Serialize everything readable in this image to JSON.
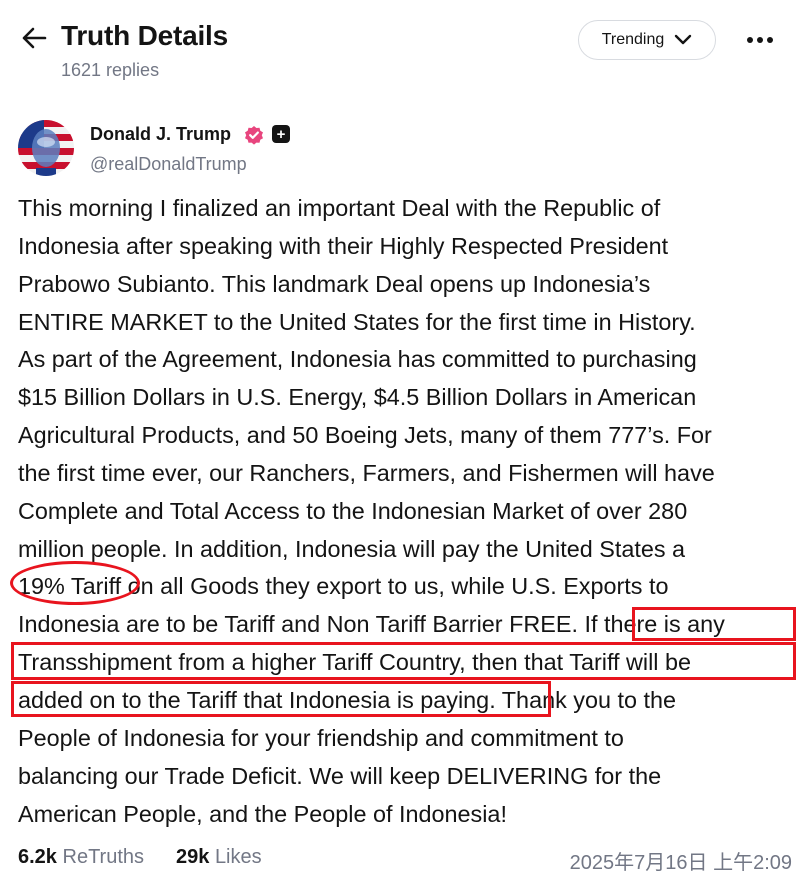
{
  "header": {
    "title": "Truth Details",
    "replies": "1621 replies",
    "trending_label": "Trending"
  },
  "author": {
    "name": "Donald J. Trump",
    "handle": "@realDonaldTrump",
    "plus_badge": "+"
  },
  "post": {
    "lines": [
      "This morning I finalized an important Deal with the Republic of",
      "Indonesia after speaking with their Highly Respected President",
      "Prabowo Subianto. This landmark Deal opens up Indonesia’s",
      "ENTIRE MARKET to the United States for the first time in History.",
      "As part of the Agreement, Indonesia has committed to purchasing",
      "$15 Billion Dollars in U.S. Energy, $4.5 Billion Dollars in American",
      "Agricultural Products, and 50 Boeing Jets, many of them 777’s. For",
      "the first time ever, our Ranchers, Farmers, and Fishermen will have",
      "Complete and Total Access to the Indonesian Market of over 280",
      "million people. In addition, Indonesia will pay the United States a",
      "19% Tariff on all Goods they export to us, while U.S. Exports to",
      "Indonesia are to be Tariff and Non Tariff Barrier FREE. If there is any",
      "Transshipment from a higher Tariff Country, then that Tariff will be",
      "added on to the Tariff that Indonesia is paying. Thank you to the",
      "People of Indonesia for your friendship and commitment to",
      "balancing our Trade Deficit. We will keep DELIVERING for the",
      "American People, and the People of Indonesia!"
    ]
  },
  "stats": {
    "retruths_count": "6.2k",
    "retruths_label": "ReTruths",
    "likes_count": "29k",
    "likes_label": "Likes",
    "timestamp": "2025年7月16日 上午2:09"
  },
  "colors": {
    "annotation": "#e8141e",
    "verified": "#e8457e",
    "muted_text": "#727785"
  }
}
